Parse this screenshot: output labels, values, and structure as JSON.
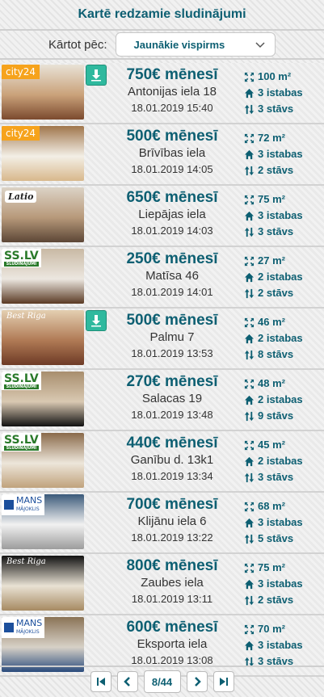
{
  "header": {
    "title": "Kartē redzamie sludinājumi"
  },
  "sort": {
    "label": "Kārtot pēc:",
    "selected": "Jaunākie vispirms"
  },
  "colors": {
    "accent": "#0d5f72",
    "favorite": "#2fb99e"
  },
  "listings": [
    {
      "source": "city24",
      "source_label": "city24",
      "favorite": true,
      "price": "750€ mēnesī",
      "address": "Antonijas iela 18",
      "date": "18.01.2019 15:40",
      "area": "100 m²",
      "rooms": "3 istabas",
      "floor": "3 stāvs",
      "room_colors": [
        "#caa27a",
        "#7b4a2e",
        "#e8e2d6"
      ]
    },
    {
      "source": "city24",
      "source_label": "city24",
      "favorite": false,
      "price": "500€ mēnesī",
      "address": "Brīvības iela",
      "date": "18.01.2019 14:05",
      "area": "72 m²",
      "rooms": "3 istabas",
      "floor": "2 stāvs",
      "room_colors": [
        "#f3efe6",
        "#d8b88c",
        "#a0764c"
      ]
    },
    {
      "source": "latio",
      "source_label": "Latio",
      "favorite": false,
      "price": "650€ mēnesī",
      "address": "Liepājas iela",
      "date": "18.01.2019 14:03",
      "area": "75 m²",
      "rooms": "3 istabas",
      "floor": "3 stāvs",
      "room_colors": [
        "#b7997a",
        "#5c4636",
        "#dcd3c6"
      ]
    },
    {
      "source": "sslv",
      "source_label": "SS.LV",
      "source_sub": "SLUDINĀJUMI",
      "favorite": false,
      "price": "250€ mēnesī",
      "address": "Matīsa 46",
      "date": "18.01.2019 14:01",
      "area": "27 m²",
      "rooms": "2 istabas",
      "floor": "2 stāvs",
      "room_colors": [
        "#ece7e0",
        "#5a3a24",
        "#c9b9a4"
      ]
    },
    {
      "source": "best",
      "source_label": "Best Riga",
      "favorite": true,
      "price": "500€ mēnesī",
      "address": "Palmu 7",
      "date": "18.01.2019 13:53",
      "area": "46 m²",
      "rooms": "2 istabas",
      "floor": "8 stāvs",
      "room_colors": [
        "#b07a55",
        "#6e3b26",
        "#e4cfb1"
      ]
    },
    {
      "source": "sslv",
      "source_label": "SS.LV",
      "source_sub": "SLUDINĀJUMI",
      "favorite": false,
      "price": "270€ mēnesī",
      "address": "Salacas 19",
      "date": "18.01.2019 13:48",
      "area": "48 m²",
      "rooms": "2 istabas",
      "floor": "9 stāvs",
      "room_colors": [
        "#d9c9b2",
        "#111111",
        "#a88e6e"
      ]
    },
    {
      "source": "sslv",
      "source_label": "SS.LV",
      "source_sub": "SLUDINĀJUMI",
      "favorite": false,
      "price": "440€ mēnesī",
      "address": "Ganību d. 13k1",
      "date": "18.01.2019 13:34",
      "area": "45 m²",
      "rooms": "2 istabas",
      "floor": "3 stāvs",
      "room_colors": [
        "#ede6da",
        "#c0a27c",
        "#8a6a4a"
      ]
    },
    {
      "source": "mans",
      "source_label": "MANS",
      "source_sub": "MĀJOKLIS",
      "favorite": false,
      "price": "700€ mēnesī",
      "address": "Klijānu iela 6",
      "date": "18.01.2019 13:22",
      "area": "68 m²",
      "rooms": "3 istabas",
      "floor": "5 stāvs",
      "room_colors": [
        "#f1f1f1",
        "#9c9c9c",
        "#3b5a7a"
      ]
    },
    {
      "source": "best",
      "source_label": "Best Riga",
      "favorite": false,
      "price": "800€ mēnesī",
      "address": "Zaubes iela",
      "date": "18.01.2019 13:11",
      "area": "75 m²",
      "rooms": "3 istabas",
      "floor": "2 stāvs",
      "room_colors": [
        "#e9e2d4",
        "#a68a62",
        "#111111"
      ]
    },
    {
      "source": "mans",
      "source_label": "MANS",
      "source_sub": "MĀJOKLIS",
      "favorite": false,
      "price": "600€ mēnesī",
      "address": "Eksporta iela",
      "date": "18.01.2019 13:08",
      "area": "70 m²",
      "rooms": "3 istabas",
      "floor": "3 stāvs",
      "room_colors": [
        "#d7d1c7",
        "#2a4b7c",
        "#8a7356"
      ]
    }
  ],
  "pagination": {
    "page": "8/44"
  },
  "icons": {
    "area": "expand-arrows-icon",
    "rooms": "home-icon",
    "floor": "up-down-arrows-icon",
    "favorite": "download-arrow-icon",
    "first": "first-page-icon",
    "prev": "chevron-left-icon",
    "next": "chevron-right-icon",
    "last": "last-page-icon"
  }
}
